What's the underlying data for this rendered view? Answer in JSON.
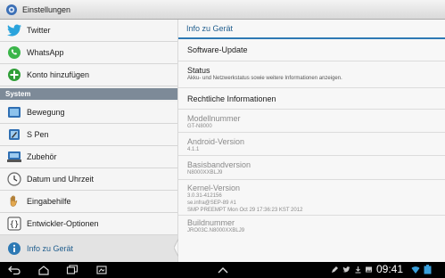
{
  "titlebar": {
    "title": "Einstellungen",
    "icon": "settings-gear-icon"
  },
  "left": {
    "items_top": [
      {
        "label": "Twitter",
        "icon": "twitter-icon"
      },
      {
        "label": "WhatsApp",
        "icon": "whatsapp-icon"
      },
      {
        "label": "Konto hinzufügen",
        "icon": "add-account-icon"
      }
    ],
    "section": "System",
    "items_system": [
      {
        "label": "Bewegung",
        "icon": "motion-icon"
      },
      {
        "label": "S Pen",
        "icon": "s-pen-icon"
      },
      {
        "label": "Zubehör",
        "icon": "accessory-icon"
      },
      {
        "label": "Datum und Uhrzeit",
        "icon": "clock-icon"
      },
      {
        "label": "Eingabehilfe",
        "icon": "hand-icon"
      },
      {
        "label": "Entwickler-Optionen",
        "icon": "developer-icon"
      },
      {
        "label": "Info zu Gerät",
        "icon": "info-icon",
        "selected": true
      }
    ]
  },
  "right": {
    "header": "Info zu Gerät",
    "software_update": "Software-Update",
    "status_title": "Status",
    "status_sub": "Akku- und Netzwerkstatus sowie weitere Informationen anzeigen.",
    "legal": "Rechtliche Informationen",
    "model_title": "Modellnummer",
    "model_value": "GT-N8000",
    "android_title": "Android-Version",
    "android_value": "4.1.1",
    "baseband_title": "Basisbandversion",
    "baseband_value": "N8000XXBLJ9",
    "kernel_title": "Kernel-Version",
    "kernel_line1": "3.0.31-412156",
    "kernel_line2": "se.infra@SEP-89 #1",
    "kernel_line3": "SMP PREEMPT Mon Oct 29 17:36:23 KST 2012",
    "build_title": "Buildnummer",
    "build_value": "JRO03C.N8000XXBLJ9"
  },
  "navbar": {
    "time": "09:41"
  },
  "colors": {
    "accent": "#2d79b4",
    "section": "#7d8a98"
  }
}
